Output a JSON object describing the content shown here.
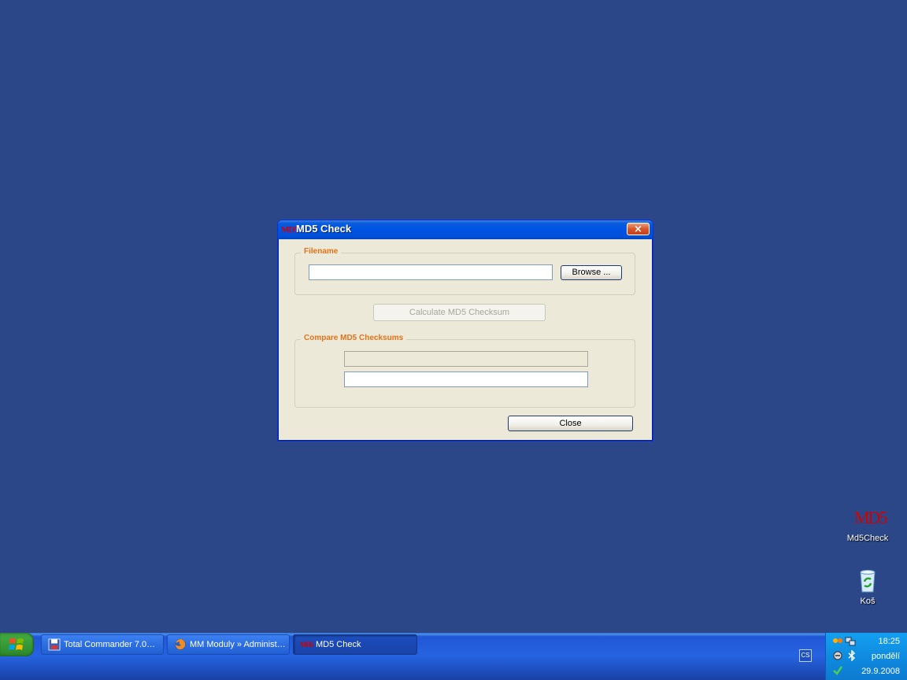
{
  "window": {
    "title": "MD5 Check",
    "icon_text": "MD5",
    "close_glyph": "×",
    "filename_group": {
      "legend": "Filename",
      "input_value": "",
      "browse_label": "Browse ..."
    },
    "calculate_label": "Calculate MD5 Checksum",
    "compare_group": {
      "legend": "Compare MD5 Checksums",
      "checksum_value": "",
      "compare_value": ""
    },
    "close_label": "Close"
  },
  "desktop_icons": [
    {
      "label": "Md5Check",
      "icon": "md5-icon",
      "glyph_text": "MD5"
    },
    {
      "label": "Koš",
      "icon": "recycle-bin-icon"
    }
  ],
  "taskbar": {
    "tasks": [
      {
        "label": "Total Commander 7.0…",
        "icon": "floppy-icon"
      },
      {
        "label": "MM Moduly » Administ…",
        "icon": "firefox-icon"
      },
      {
        "label": "MD5 Check",
        "icon": "md5-icon",
        "icon_text": "MD5",
        "active": true
      }
    ],
    "language": "CS",
    "clock": {
      "time": "18:25",
      "day": "pondělí",
      "date": "29.9.2008"
    }
  },
  "colors": {
    "desktop": "#2c4787",
    "legend": "#e0731a",
    "titlebar": "#0054e3",
    "md5_red": "#d40000"
  }
}
